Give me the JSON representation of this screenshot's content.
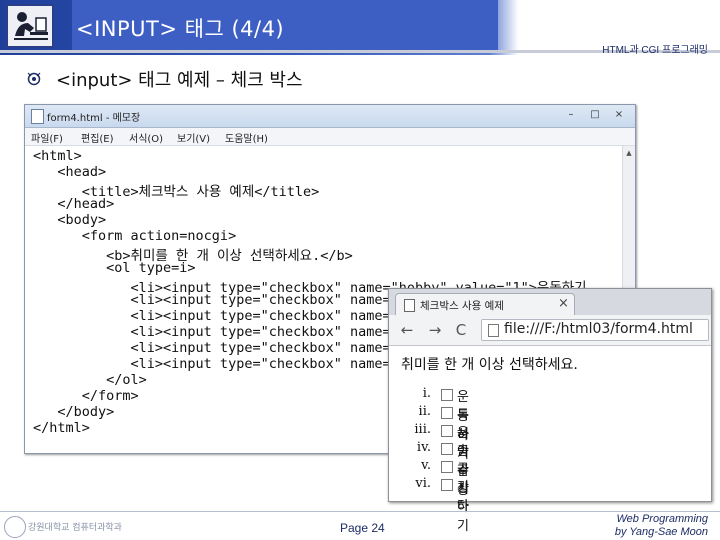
{
  "slide": {
    "title": "<INPUT> 태그 (4/4)",
    "course": "HTML과 CGI 프로그래밍",
    "subtitle": "<input> 태그 예제 – 체크 박스",
    "page": "Page 24",
    "credit_line1": "Web Programming",
    "credit_line2": "by Yang-Sae Moon",
    "school": "강원대학교 컴퓨터과학과"
  },
  "notepad": {
    "title": "form4.html - 메모장",
    "menu": [
      "파일(F)",
      "편집(E)",
      "서식(O)",
      "보기(V)",
      "도움말(H)"
    ],
    "controls": [
      "–",
      "□",
      "×"
    ],
    "code_lines": [
      "<html>",
      "   <head>",
      "      <title>체크박스 사용 예제</title>",
      "   </head>",
      "   <body>",
      "      <form action=nocgi>",
      "         <b>취미를 한 개 이상 선택하세요.</b>",
      "         <ol type=i>",
      "            <li><input type=\"checkbox\" name=\"hobby\" value=\"1\">운동하기",
      "            <li><input type=\"checkbox\" name=",
      "            <li><input type=\"checkbox\" name=",
      "            <li><input type=\"checkbox\" name=",
      "            <li><input type=\"checkbox\" name=",
      "            <li><input type=\"checkbox\" name=",
      "         </ol>",
      "      </form>",
      "   </body>",
      "</html>"
    ]
  },
  "browser": {
    "tab_title": "체크박스 사용 예제",
    "tab_close": "×",
    "back": "←",
    "forward": "→",
    "reload": "C",
    "url": "file:///F:/html03/form4.html",
    "heading": "취미를 한 개 이상 선택하세요.",
    "items": [
      {
        "numeral": "i.",
        "label": "운동하기"
      },
      {
        "numeral": "ii.",
        "label": "독서"
      },
      {
        "numeral": "iii.",
        "label": "음악감상"
      },
      {
        "numeral": "iv.",
        "label": "춤추기"
      },
      {
        "numeral": "v.",
        "label": "공상하기"
      },
      {
        "numeral": "vi.",
        "label": "기타"
      }
    ]
  },
  "colors": {
    "title_bar": "#3d5ec2",
    "text_dark_blue": "#1d2c66"
  }
}
